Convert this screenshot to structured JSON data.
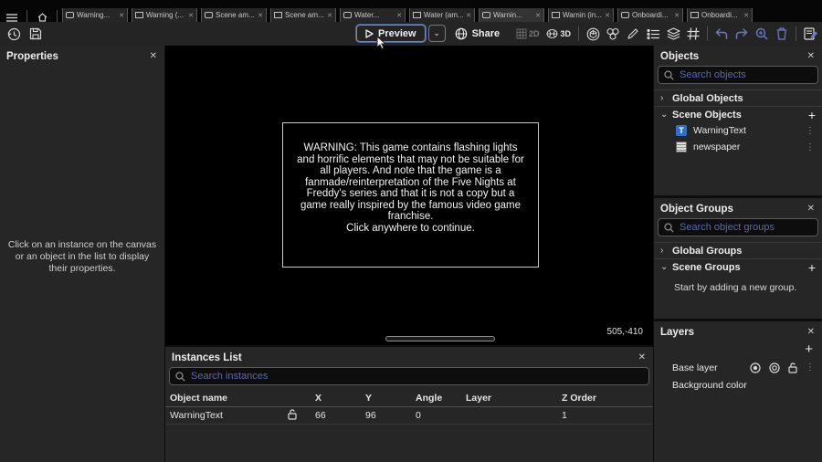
{
  "glyphs": {
    "close": "✕",
    "dots": "⋮",
    "chevron_collapsed": "›",
    "chevron_expanded": "⌄",
    "chevron_down": "⌄",
    "plus": "+",
    "text_object_letter": "T"
  },
  "tab_bar": {
    "tabs": [
      {
        "label": "Warning..."
      },
      {
        "label": "Warning (..."
      },
      {
        "label": "Scene am..."
      },
      {
        "label": "Scene am..."
      },
      {
        "label": "Water..."
      },
      {
        "label": "Water (am..."
      },
      {
        "label": "Warnin..."
      },
      {
        "label": "Warnin (in..."
      },
      {
        "label": "Onboardi..."
      },
      {
        "label": "Onboardi..."
      }
    ]
  },
  "toolbar": {
    "preview_label": "Preview",
    "share_label": "Share",
    "toggle_2d": "2D",
    "toggle_3d": "3D"
  },
  "properties_panel": {
    "title": "Properties",
    "placeholder": "Click on an instance on the canvas or an object in the list to display their properties."
  },
  "canvas": {
    "warning_text": "WARNING: This game contains flashing lights\nand horrific elements that may not be suitable for\nall players. And note that the game is a\nfanmade/reinterpretation of the Five Nights at\nFreddy's series and that it is not a copy but a\ngame really inspired by the famous video game\nfranchise.\nClick anywhere to continue.",
    "coordinates": "505,-410"
  },
  "instances_panel": {
    "title": "Instances List",
    "search_placeholder": "Search instances",
    "columns": [
      "Object name",
      "X",
      "Y",
      "Angle",
      "Layer",
      "Z Order"
    ],
    "rows": [
      {
        "name": "WarningText",
        "x": "66",
        "y": "96",
        "angle": "0",
        "layer": "",
        "z_order": "1"
      }
    ]
  },
  "objects_panel": {
    "title": "Objects",
    "search_placeholder": "Search objects",
    "global_section": "Global Objects",
    "scene_section": "Scene Objects",
    "items": [
      {
        "label": "WarningText"
      },
      {
        "label": "newspaper"
      }
    ]
  },
  "groups_panel": {
    "title": "Object Groups",
    "search_placeholder": "Search object groups",
    "global_section": "Global Groups",
    "scene_section": "Scene Groups",
    "empty_text": "Start by adding a new group."
  },
  "layers_panel": {
    "title": "Layers",
    "rows": [
      {
        "label": "Base layer"
      },
      {
        "label": "Background color"
      }
    ]
  }
}
